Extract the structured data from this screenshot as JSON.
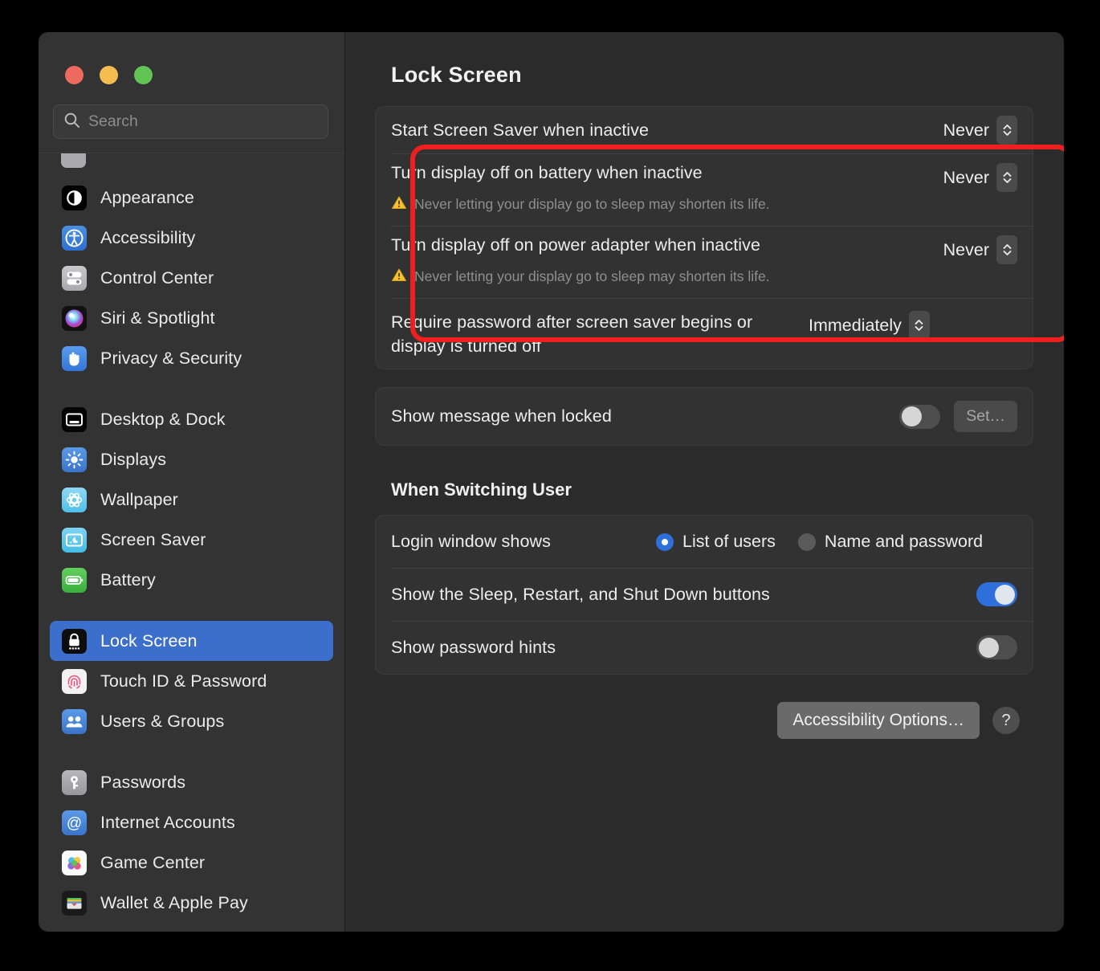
{
  "window": {
    "traffic_lights": [
      "close",
      "minimize",
      "zoom"
    ],
    "colors": {
      "close": "#ed6a5e",
      "minimize": "#f5bd4f",
      "zoom": "#61c454",
      "accent": "#2f6fdc",
      "selection": "#3c6ecc",
      "highlight": "#ef1f1f",
      "warning": "#f5c032"
    }
  },
  "search": {
    "placeholder": "Search",
    "value": "",
    "icon": "search-icon"
  },
  "sidebar": {
    "groups": [
      {
        "items": [
          {
            "label": "Appearance",
            "icon": "appearance-icon",
            "selected": false
          },
          {
            "label": "Accessibility",
            "icon": "accessibility-icon",
            "selected": false
          },
          {
            "label": "Control Center",
            "icon": "control-center-icon",
            "selected": false
          },
          {
            "label": "Siri & Spotlight",
            "icon": "siri-icon",
            "selected": false
          },
          {
            "label": "Privacy & Security",
            "icon": "privacy-security-icon",
            "selected": false
          }
        ]
      },
      {
        "items": [
          {
            "label": "Desktop & Dock",
            "icon": "desktop-dock-icon",
            "selected": false
          },
          {
            "label": "Displays",
            "icon": "displays-icon",
            "selected": false
          },
          {
            "label": "Wallpaper",
            "icon": "wallpaper-icon",
            "selected": false
          },
          {
            "label": "Screen Saver",
            "icon": "screen-saver-icon",
            "selected": false
          },
          {
            "label": "Battery",
            "icon": "battery-icon",
            "selected": false
          }
        ]
      },
      {
        "items": [
          {
            "label": "Lock Screen",
            "icon": "lock-screen-icon",
            "selected": true
          },
          {
            "label": "Touch ID & Password",
            "icon": "touch-id-icon",
            "selected": false
          },
          {
            "label": "Users & Groups",
            "icon": "users-groups-icon",
            "selected": false
          }
        ]
      },
      {
        "items": [
          {
            "label": "Passwords",
            "icon": "passwords-icon",
            "selected": false
          },
          {
            "label": "Internet Accounts",
            "icon": "internet-accounts-icon",
            "selected": false
          },
          {
            "label": "Game Center",
            "icon": "game-center-icon",
            "selected": false
          },
          {
            "label": "Wallet & Apple Pay",
            "icon": "wallet-icon",
            "selected": false
          }
        ]
      }
    ]
  },
  "main": {
    "title": "Lock Screen",
    "group_one": {
      "rows": [
        {
          "label": "Start Screen Saver when inactive",
          "value": "Never",
          "warning": null
        },
        {
          "label": "Turn display off on battery when inactive",
          "value": "Never",
          "warning": "Never letting your display go to sleep may shorten its life."
        },
        {
          "label": "Turn display off on power adapter when inactive",
          "value": "Never",
          "warning": "Never letting your display go to sleep may shorten its life."
        },
        {
          "label": "Require password after screen saver begins or display is turned off",
          "value": "Immediately",
          "warning": null
        }
      ]
    },
    "group_two": {
      "message_row": {
        "label": "Show message when locked",
        "toggle_on": false,
        "button_label": "Set…"
      }
    },
    "switching_user": {
      "heading": "When Switching User",
      "login_window": {
        "label": "Login window shows",
        "options": [
          {
            "label": "List of users",
            "selected": true
          },
          {
            "label": "Name and password",
            "selected": false
          }
        ]
      },
      "rows": [
        {
          "label": "Show the Sleep, Restart, and Shut Down buttons",
          "toggle_on": true
        },
        {
          "label": "Show password hints",
          "toggle_on": false
        }
      ]
    },
    "footer": {
      "accessibility_button": "Accessibility Options…",
      "help_button": "?"
    }
  },
  "annotation": {
    "type": "red-highlight-box",
    "covers": "first three screen-saver / display-off rows"
  }
}
